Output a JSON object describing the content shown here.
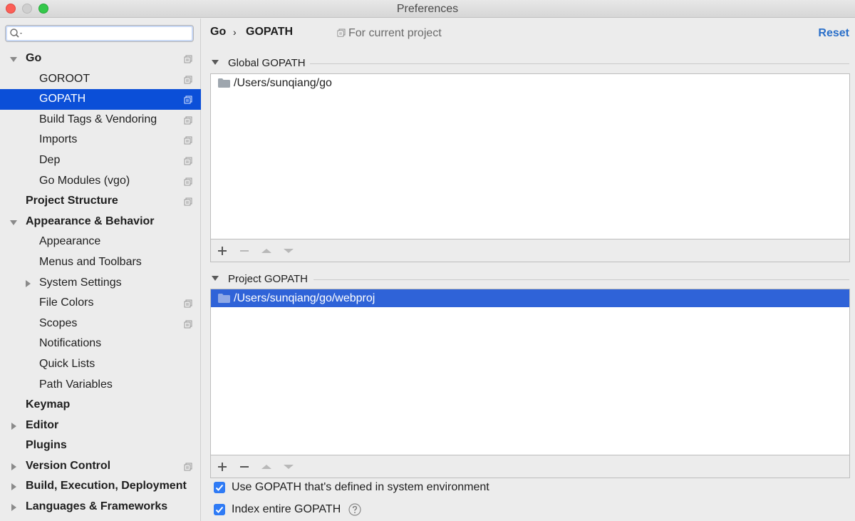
{
  "window": {
    "title": "Preferences"
  },
  "sidebar": {
    "search": {
      "value": "",
      "placeholder": ""
    },
    "items": [
      {
        "label": "Go",
        "level": 0,
        "expander": "expanded",
        "copy": true
      },
      {
        "label": "GOROOT",
        "level": 1,
        "expander": "none",
        "copy": true
      },
      {
        "label": "GOPATH",
        "level": 1,
        "expander": "none",
        "copy": true,
        "selected": true
      },
      {
        "label": "Build Tags & Vendoring",
        "level": 1,
        "expander": "none",
        "copy": true
      },
      {
        "label": "Imports",
        "level": 1,
        "expander": "none",
        "copy": true
      },
      {
        "label": "Dep",
        "level": 1,
        "expander": "none",
        "copy": true
      },
      {
        "label": "Go Modules (vgo)",
        "level": 1,
        "expander": "none",
        "copy": true
      },
      {
        "label": "Project Structure",
        "level": 0,
        "expander": "none",
        "copy": true
      },
      {
        "label": "Appearance & Behavior",
        "level": 0,
        "expander": "expanded",
        "copy": false
      },
      {
        "label": "Appearance",
        "level": 1,
        "expander": "none",
        "copy": false
      },
      {
        "label": "Menus and Toolbars",
        "level": 1,
        "expander": "none",
        "copy": false
      },
      {
        "label": "System Settings",
        "level": 1,
        "expander": "collapsed",
        "copy": false
      },
      {
        "label": "File Colors",
        "level": 1,
        "expander": "none",
        "copy": true
      },
      {
        "label": "Scopes",
        "level": 1,
        "expander": "none",
        "copy": true
      },
      {
        "label": "Notifications",
        "level": 1,
        "expander": "none",
        "copy": false
      },
      {
        "label": "Quick Lists",
        "level": 1,
        "expander": "none",
        "copy": false
      },
      {
        "label": "Path Variables",
        "level": 1,
        "expander": "none",
        "copy": false
      },
      {
        "label": "Keymap",
        "level": 0,
        "expander": "none",
        "copy": false
      },
      {
        "label": "Editor",
        "level": 0,
        "expander": "collapsed",
        "copy": false
      },
      {
        "label": "Plugins",
        "level": 0,
        "expander": "none",
        "copy": false
      },
      {
        "label": "Version Control",
        "level": 0,
        "expander": "collapsed",
        "copy": true
      },
      {
        "label": "Build, Execution, Deployment",
        "level": 0,
        "expander": "collapsed",
        "copy": false
      },
      {
        "label": "Languages & Frameworks",
        "level": 0,
        "expander": "collapsed",
        "copy": false
      }
    ]
  },
  "header": {
    "breadcrumb_root": "Go",
    "breadcrumb_sep": "›",
    "breadcrumb_current": "GOPATH",
    "scope_note": "For current project",
    "reset_label": "Reset"
  },
  "global_gopath": {
    "title": "Global GOPATH",
    "entries": [
      "/Users/sunqiang/go"
    ],
    "toolbar": [
      "add-icon",
      "remove-icon",
      "move-up-icon",
      "move-down-icon"
    ]
  },
  "project_gopath": {
    "title": "Project GOPATH",
    "entries": [
      "/Users/sunqiang/go/webproj"
    ],
    "selected_index": 0,
    "toolbar": [
      "add-icon",
      "remove-icon",
      "move-up-icon",
      "move-down-icon"
    ]
  },
  "options": {
    "use_system_gopath": {
      "label": "Use GOPATH that's defined in system environment",
      "checked": true
    },
    "index_entire_gopath": {
      "label": "Index entire GOPATH",
      "checked": true
    }
  },
  "colors": {
    "selection": "#0b4fd8",
    "list_selection": "#2f63d8",
    "link": "#2a6fc9",
    "checkbox": "#2f7bf5"
  }
}
